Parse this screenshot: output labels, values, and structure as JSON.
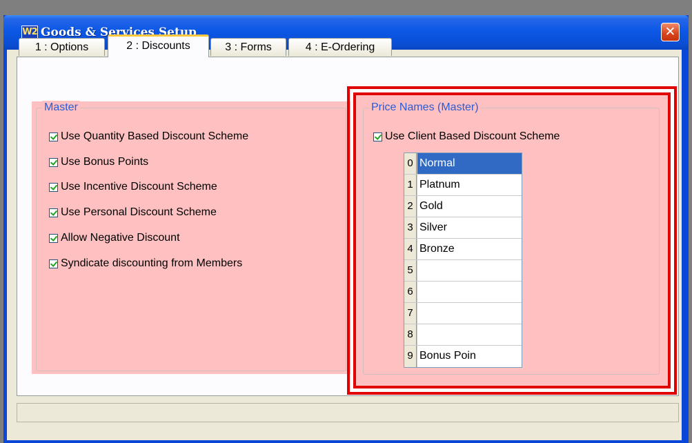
{
  "window": {
    "title": "Goods & Services Setup",
    "app_icon_text": "W2",
    "close_glyph": "✕"
  },
  "tabs": [
    {
      "label": "1 : Options",
      "active": false
    },
    {
      "label": "2 : Discounts",
      "active": true
    },
    {
      "label": "3 : Forms",
      "active": false
    },
    {
      "label": "4 : E-Ordering",
      "active": false
    }
  ],
  "master": {
    "label": "Master",
    "options": [
      {
        "label": "Use Quantity Based Discount Scheme",
        "checked": true
      },
      {
        "label": "Use Bonus Points",
        "checked": true
      },
      {
        "label": "Use Incentive Discount Scheme",
        "checked": true
      },
      {
        "label": "Use Personal  Discount Scheme",
        "checked": true
      },
      {
        "label": "Allow Negative Discount",
        "checked": true
      },
      {
        "label": "Syndicate discounting from Members",
        "checked": true
      }
    ]
  },
  "price_names": {
    "label": "Price Names (Master)",
    "client_scheme": {
      "label": "Use Client Based Discount Scheme",
      "checked": true
    },
    "rows": [
      {
        "index": "0",
        "name": "Normal",
        "selected": true
      },
      {
        "index": "1",
        "name": "Platnum",
        "selected": false
      },
      {
        "index": "2",
        "name": "Gold",
        "selected": false
      },
      {
        "index": "3",
        "name": "Silver",
        "selected": false
      },
      {
        "index": "4",
        "name": "Bronze",
        "selected": false
      },
      {
        "index": "5",
        "name": "",
        "selected": false
      },
      {
        "index": "6",
        "name": "",
        "selected": false
      },
      {
        "index": "7",
        "name": "",
        "selected": false
      },
      {
        "index": "8",
        "name": "",
        "selected": false
      },
      {
        "index": "9",
        "name": "Bonus Poin",
        "selected": false
      }
    ]
  },
  "colors": {
    "panel_bg": "#fec0c0",
    "group_label": "#2a5bd8",
    "highlight_border": "#e10000",
    "selection": "#316ac5"
  }
}
